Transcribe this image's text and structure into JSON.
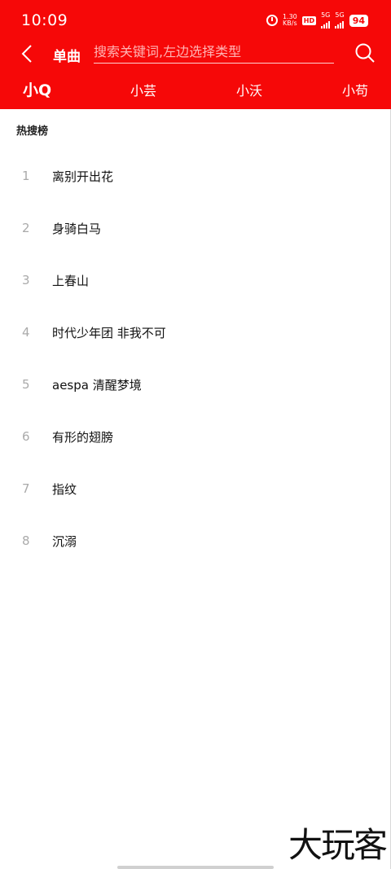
{
  "status_bar": {
    "time": "10:09",
    "net_speed": "1.30",
    "net_unit": "KB/s",
    "hd_label": "HD",
    "sig1": "5G",
    "sig2": "5G",
    "battery": "94"
  },
  "header": {
    "type_label": "单曲",
    "search_placeholder": "搜索关键词,左边选择类型",
    "tabs": [
      {
        "label": "小Q",
        "active": true
      },
      {
        "label": "小芸",
        "active": false
      },
      {
        "label": "小沃",
        "active": false
      },
      {
        "label": "小苟",
        "active": false
      }
    ]
  },
  "hot": {
    "title": "热搜榜",
    "items": [
      {
        "rank": "1",
        "name": "离别开出花"
      },
      {
        "rank": "2",
        "name": "身骑白马"
      },
      {
        "rank": "3",
        "name": "上春山"
      },
      {
        "rank": "4",
        "name": "时代少年团 非我不可"
      },
      {
        "rank": "5",
        "name": "aespa 清醒梦境"
      },
      {
        "rank": "6",
        "name": "有形的翅膀"
      },
      {
        "rank": "7",
        "name": "指纹"
      },
      {
        "rank": "8",
        "name": "沉溺"
      }
    ]
  },
  "watermark": "大玩客",
  "colors": {
    "accent": "#f60808"
  }
}
